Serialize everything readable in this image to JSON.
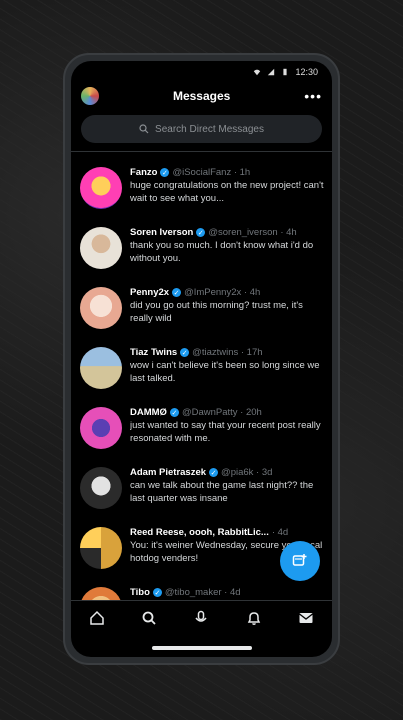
{
  "status": {
    "time": "12:30"
  },
  "header": {
    "title": "Messages",
    "more": "•••"
  },
  "search": {
    "placeholder": "Search Direct Messages"
  },
  "conversations": [
    {
      "name": "Fanzo",
      "handle": "@iSocialFanz · 1h",
      "message": "huge congratulations on the new project! can't wait to see what you...",
      "avatar_colors": [
        "#ff3fb4",
        "#6b2db5"
      ]
    },
    {
      "name": "Soren Iverson",
      "handle": "@soren_iverson · 4h",
      "message": "thank you so much. I don't know what i'd do without you.",
      "avatar_colors": [
        "#e8e2d8",
        "#c7b9a6"
      ]
    },
    {
      "name": "Penny2x",
      "handle": "@ImPenny2x · 4h",
      "message": "did you go out this morning? trust me, it's really wild",
      "avatar_colors": [
        "#f2d3c4",
        "#e8a892"
      ]
    },
    {
      "name": "Tiaz Twins",
      "handle": "@tiaztwins · 17h",
      "message": "wow i can't believe it's been so long since we last talked.",
      "avatar_colors": [
        "#9bbfe0",
        "#d3c59a"
      ]
    },
    {
      "name": "DAMMØ",
      "handle": "@DawnPatty · 20h",
      "message": "just wanted to say that your recent post really resonated with me.",
      "avatar_colors": [
        "#e64fb8",
        "#5b3fb3"
      ]
    },
    {
      "name": "Adam Pietraszek",
      "handle": "@pia6k · 3d",
      "message": "can we talk about the game last night?? the last quarter was insane",
      "avatar_colors": [
        "#7a3fd6",
        "#2b2b2b"
      ]
    },
    {
      "name": "Reed Reese, oooh, RabbitLic...",
      "handle": "· 4d",
      "message": "You: it's weiner Wednesday, secure your local hotdog venders!",
      "avatar_colors": [
        "#d9a23b",
        "#2a2a2a"
      ]
    },
    {
      "name": "Tibo",
      "handle": "@tibo_maker · 4d",
      "message": "",
      "avatar_colors": [
        "#e07a3a",
        "#f0c080"
      ]
    }
  ],
  "tabs": [
    "home-icon",
    "search-icon",
    "spaces-icon",
    "notifications-icon",
    "messages-icon"
  ],
  "colors": {
    "accent": "#1d9bf0",
    "background": "#000000"
  }
}
